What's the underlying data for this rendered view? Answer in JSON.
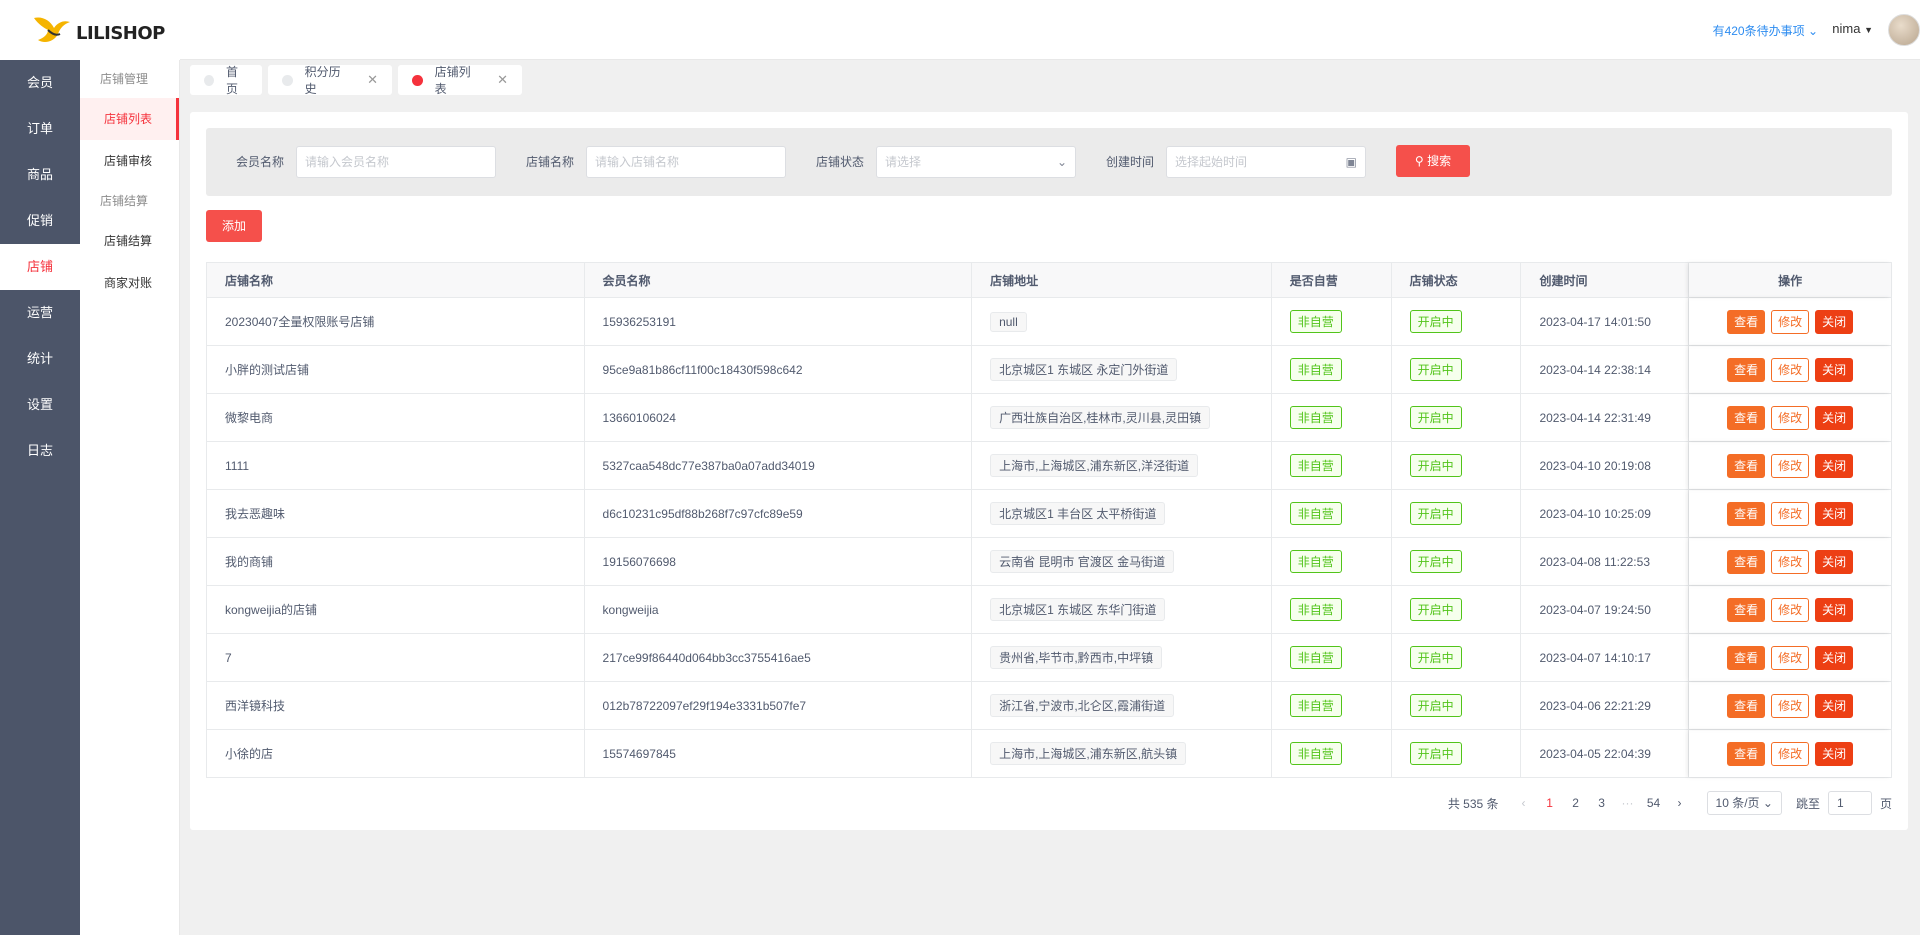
{
  "brand": {
    "name": "LILISHOP"
  },
  "header": {
    "todo": "有420条待办事项",
    "user": "nima"
  },
  "mainnav": [
    "会员",
    "订单",
    "商品",
    "促销",
    "店铺",
    "运营",
    "统计",
    "设置",
    "日志"
  ],
  "subnav": {
    "group1": "店铺管理",
    "item_list": "店铺列表",
    "item_audit": "店铺审核",
    "group2": "店铺结算",
    "item_settle": "店铺结算",
    "item_recon": "商家对账"
  },
  "tabs": [
    {
      "label": "首页"
    },
    {
      "label": "积分历史",
      "close": "✕"
    },
    {
      "label": "店铺列表",
      "close": "✕"
    }
  ],
  "search": {
    "member_label": "会员名称",
    "member_placeholder": "请输入会员名称",
    "store_label": "店铺名称",
    "store_placeholder": "请输入店铺名称",
    "status_label": "店铺状态",
    "status_placeholder": "请选择",
    "time_label": "创建时间",
    "time_placeholder": "选择起始时间",
    "search_button": "搜索"
  },
  "add_button": "添加",
  "table": {
    "columns": [
      "店铺名称",
      "会员名称",
      "店铺地址",
      "是否自营",
      "店铺状态",
      "创建时间",
      "操作"
    ],
    "rows": [
      {
        "store": "20230407全量权限账号店铺",
        "member": "15936253191",
        "address": "null",
        "self": "非自营",
        "status": "开启中",
        "time": "2023-04-17 14:01:50"
      },
      {
        "store": "小胖的测试店铺",
        "member": "95ce9a81b86cf11f00c18430f598c642",
        "address": "北京城区1 东城区 永定门外街道",
        "self": "非自营",
        "status": "开启中",
        "time": "2023-04-14 22:38:14"
      },
      {
        "store": "微黎电商",
        "member": "13660106024",
        "address": "广西壮族自治区,桂林市,灵川县,灵田镇",
        "self": "非自营",
        "status": "开启中",
        "time": "2023-04-14 22:31:49"
      },
      {
        "store": "1111",
        "member": "5327caa548dc77e387ba0a07add34019",
        "address": "上海市,上海城区,浦东新区,洋泾街道",
        "self": "非自营",
        "status": "开启中",
        "time": "2023-04-10 20:19:08"
      },
      {
        "store": "我去恶趣味",
        "member": "d6c10231c95df88b268f7c97cfc89e59",
        "address": "北京城区1 丰台区 太平桥街道",
        "self": "非自营",
        "status": "开启中",
        "time": "2023-04-10 10:25:09"
      },
      {
        "store": "我的商铺",
        "member": "19156076698",
        "address": "云南省 昆明市 官渡区 金马街道",
        "self": "非自营",
        "status": "开启中",
        "time": "2023-04-08 11:22:53"
      },
      {
        "store": "kongweijia的店铺",
        "member": "kongweijia",
        "address": "北京城区1 东城区 东华门街道",
        "self": "非自营",
        "status": "开启中",
        "time": "2023-04-07 19:24:50"
      },
      {
        "store": "7",
        "member": "217ce99f86440d064bb3cc3755416ae5",
        "address": "贵州省,毕节市,黔西市,中坪镇",
        "self": "非自营",
        "status": "开启中",
        "time": "2023-04-07 14:10:17"
      },
      {
        "store": "西洋镜科技",
        "member": "012b78722097ef29f194e3331b507fe7",
        "address": "浙江省,宁波市,北仑区,霞浦街道",
        "self": "非自营",
        "status": "开启中",
        "time": "2023-04-06 22:21:29"
      },
      {
        "store": "小徐的店",
        "member": "15574697845",
        "address": "上海市,上海城区,浦东新区,航头镇",
        "self": "非自营",
        "status": "开启中",
        "time": "2023-04-05 22:04:39"
      }
    ],
    "ops": {
      "view": "查看",
      "edit": "修改",
      "close": "关闭"
    }
  },
  "pagination": {
    "total": "共 535 条",
    "pages": [
      "1",
      "2",
      "3",
      "···",
      "54"
    ],
    "prev": "‹",
    "next": "›",
    "page_size": "10 条/页",
    "jump_label": "跳至",
    "jump_value": "1",
    "jump_suffix": "页"
  },
  "colors": {
    "accent": "#f5504b",
    "nav_bg": "#4c5569",
    "green": "#52c41a",
    "orange": "#f46d26"
  }
}
